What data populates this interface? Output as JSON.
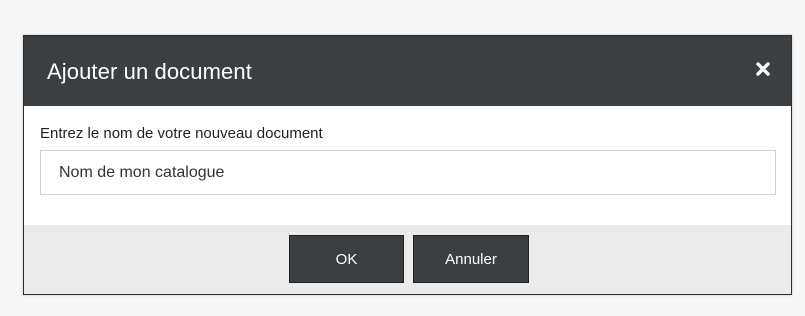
{
  "dialog": {
    "title": "Ajouter un document",
    "close_icon": "close-x-icon",
    "prompt_label": "Entrez le nom de votre nouveau document",
    "input": {
      "value": "Nom de mon catalogue",
      "placeholder": ""
    },
    "buttons": {
      "ok_label": "OK",
      "cancel_label": "Annuler"
    }
  },
  "colors": {
    "titlebar": "#3b3f42",
    "button": "#3b3f42",
    "footer": "#ebebeb",
    "page_background": "#f7f7f7"
  }
}
